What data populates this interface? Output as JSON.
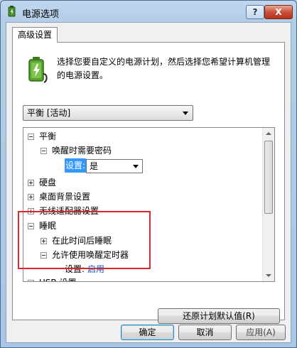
{
  "window": {
    "title": "电源选项",
    "help_label": "?",
    "close_label": "X"
  },
  "tab": {
    "label": "高级设置"
  },
  "intro_text": "选择您要自定义的电源计划，然后选择您希望计算机管理的电源设置。",
  "plan_select": {
    "value": "平衡 [活动]"
  },
  "tree": {
    "balanced": "平衡",
    "wake_password": "唤醒时需要密码",
    "wake_setting_label": "设置:",
    "wake_setting_value": "是",
    "disk": "硬盘",
    "desktop_background": "桌面背景设置",
    "wireless": "无线适配器设置",
    "sleep": "睡眠",
    "sleep_after": "在此时间后睡眠",
    "wake_timers": "允许使用唤醒定时器",
    "timers_setting_label": "设置:",
    "timers_setting_value": "启用",
    "usb": "USB 设置"
  },
  "buttons": {
    "restore": "还原计划默认值(R)",
    "ok": "确定",
    "cancel": "取消",
    "apply": "应用(A)"
  },
  "colors": {
    "highlight_border": "#d9272e",
    "link_value": "#0b55c4",
    "selection": "#3399ff"
  }
}
